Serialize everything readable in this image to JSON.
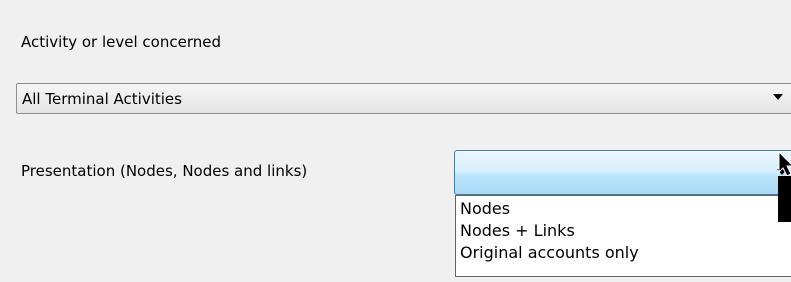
{
  "activity": {
    "label": "Activity or level concerned",
    "selected_value": "All Terminal Activities",
    "arrow_icon": "dropdown-arrow-icon"
  },
  "presentation": {
    "label": "Presentation (Nodes, Nodes and  links)",
    "selected_value": "",
    "arrow_icon": "dropdown-arrow-icon",
    "options": [
      "Nodes",
      "Nodes + Links",
      "Original accounts only"
    ]
  },
  "colors": {
    "background": "#f0f0f0",
    "combo_focus_border": "#3c7fb1",
    "combo_focus_fill": "#bee6fd"
  }
}
